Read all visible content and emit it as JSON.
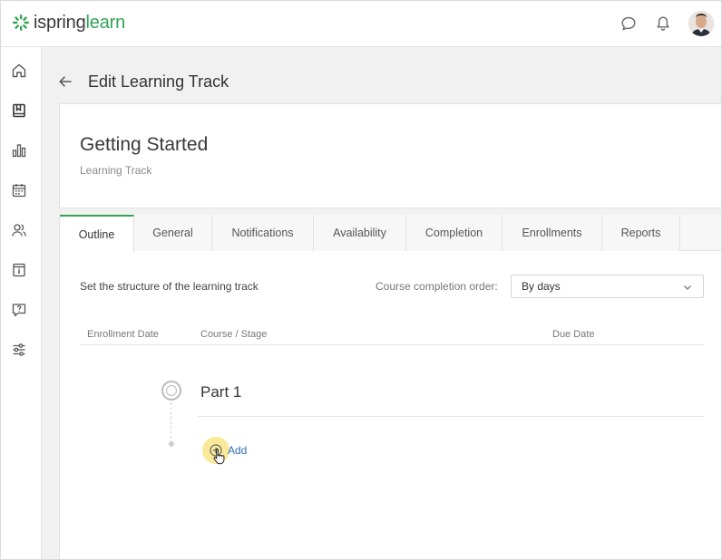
{
  "app": {
    "logo_part1": "ispring",
    "logo_part2": "learn",
    "brand_color": "#33a457"
  },
  "topbar": {
    "icons": [
      "chat-icon",
      "bell-icon",
      "user-avatar"
    ]
  },
  "sidebar": {
    "items": [
      "home-icon",
      "book-icon",
      "reports-chart-icon",
      "calendar-icon",
      "users-icon",
      "info-card-icon",
      "question-icon",
      "settings-sliders-icon"
    ]
  },
  "header": {
    "title": "Edit Learning Track"
  },
  "card": {
    "title": "Getting Started",
    "subtitle": "Learning Track"
  },
  "tabs": [
    {
      "label": "Outline",
      "active": true
    },
    {
      "label": "General",
      "active": false
    },
    {
      "label": "Notifications",
      "active": false
    },
    {
      "label": "Availability",
      "active": false
    },
    {
      "label": "Completion",
      "active": false
    },
    {
      "label": "Enrollments",
      "active": false
    },
    {
      "label": "Reports",
      "active": false
    }
  ],
  "outline": {
    "structure_label": "Set the structure of the learning track",
    "order_label": "Course completion order:",
    "order_value": "By days",
    "columns": [
      "Enrollment Date",
      "Course / Stage",
      "Due Date"
    ],
    "stage_name": "Part 1",
    "add_label": "Add"
  }
}
